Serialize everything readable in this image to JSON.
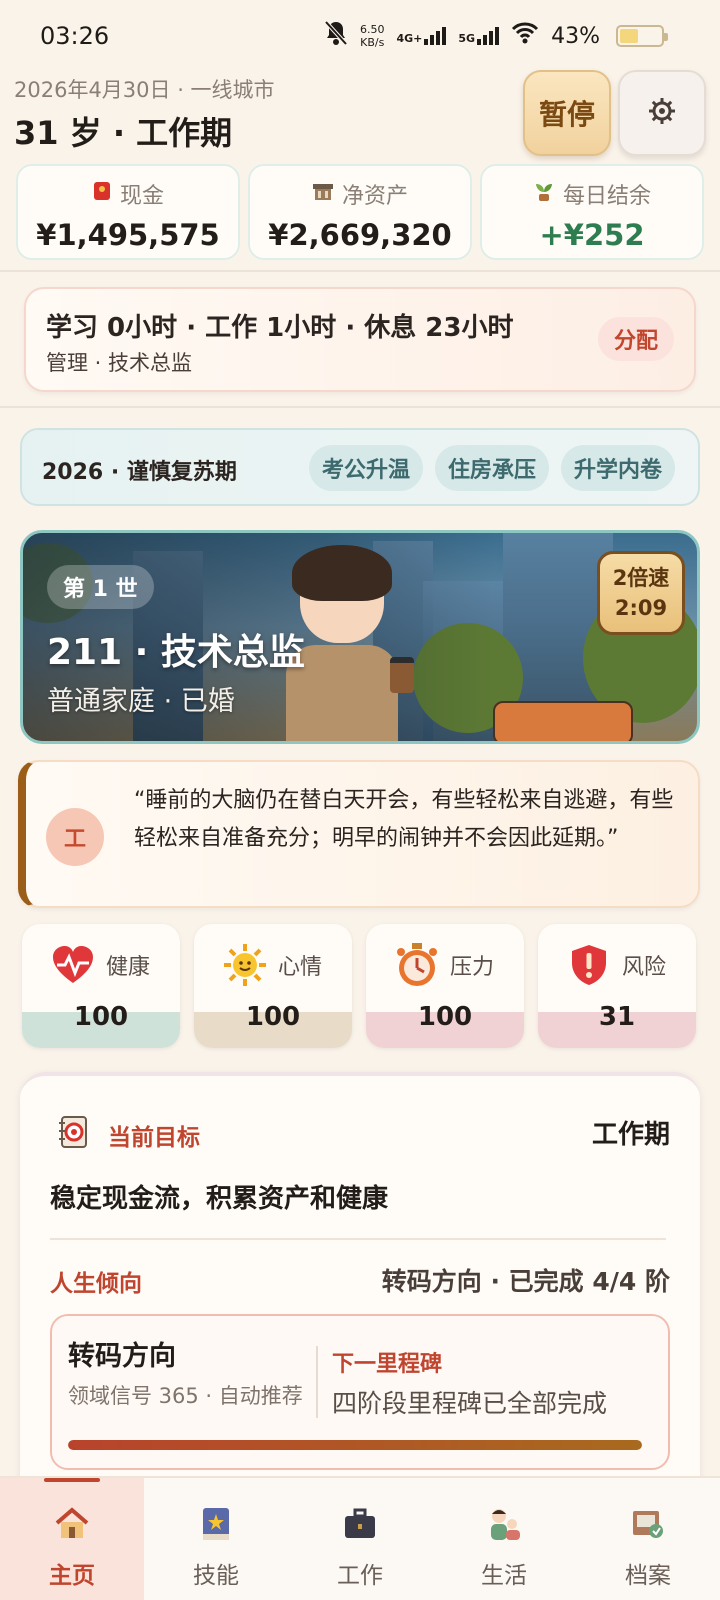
{
  "status_bar": {
    "time": "03:26",
    "speed_value": "6.50",
    "speed_unit": "KB/s",
    "net1": "4G+",
    "net2": "5G",
    "battery": "43%"
  },
  "header": {
    "subtitle": "2026年4月30日 · 一线城市",
    "title": "31 岁 · 工作期",
    "pause_label": "暂停"
  },
  "stats": [
    {
      "label": "现金",
      "value": "¥1,495,575",
      "icon": "red-packet-icon"
    },
    {
      "label": "净资产",
      "value": "¥2,669,320",
      "icon": "bank-icon"
    },
    {
      "label": "每日结余",
      "value": "+¥252",
      "icon": "sprout-icon",
      "color": "#2e7d50"
    }
  ],
  "allocation": {
    "summary": "学习 0小时 · 工作 1小时 · 休息 23小时",
    "role": "管理 · 技术总监",
    "button": "分配"
  },
  "era": {
    "label": "2026 · 谨慎复苏期",
    "chips": [
      "考公升温",
      "住房承压",
      "升学内卷"
    ]
  },
  "banner": {
    "generation": "第 1 世",
    "title": "211 · 技术总监",
    "subtitle": "普通家庭 · 已婚",
    "speed_line1": "2倍速",
    "speed_line2": "2:09"
  },
  "quote": {
    "badge": "工",
    "text": "“睡前的大脑仍在替白天开会，有些轻松来自逃避，有些轻松来自准备充分；明早的闹钟并不会因此延期。”"
  },
  "gauges": [
    {
      "label": "健康",
      "value": "100",
      "icon": "heart-icon",
      "color": "#cfe2da"
    },
    {
      "label": "心情",
      "value": "100",
      "icon": "sun-icon",
      "color": "#e8dcc8"
    },
    {
      "label": "压力",
      "value": "100",
      "icon": "stopwatch-icon",
      "color": "#f1d2d4"
    },
    {
      "label": "风险",
      "value": "31",
      "icon": "shield-alert-icon",
      "color": "#f1d2d4"
    }
  ],
  "goal": {
    "title": "当前目标",
    "phase": "工作期",
    "description": "稳定现金流，积累资产和健康",
    "tendency_label": "人生倾向",
    "tendency_value": "转码方向 · 已完成 4/4 阶",
    "track": {
      "name": "转码方向",
      "signal": "领域信号 365 · 自动推荐",
      "milestone_label": "下一里程碑",
      "milestone_value": "四阶段里程碑已全部完成",
      "progress": 1.0
    }
  },
  "nav": [
    {
      "label": "主页",
      "icon": "home-icon",
      "active": true
    },
    {
      "label": "技能",
      "icon": "book-icon",
      "active": false
    },
    {
      "label": "工作",
      "icon": "briefcase-icon",
      "active": false
    },
    {
      "label": "生活",
      "icon": "people-icon",
      "active": false
    },
    {
      "label": "档案",
      "icon": "archive-icon",
      "active": false
    }
  ]
}
